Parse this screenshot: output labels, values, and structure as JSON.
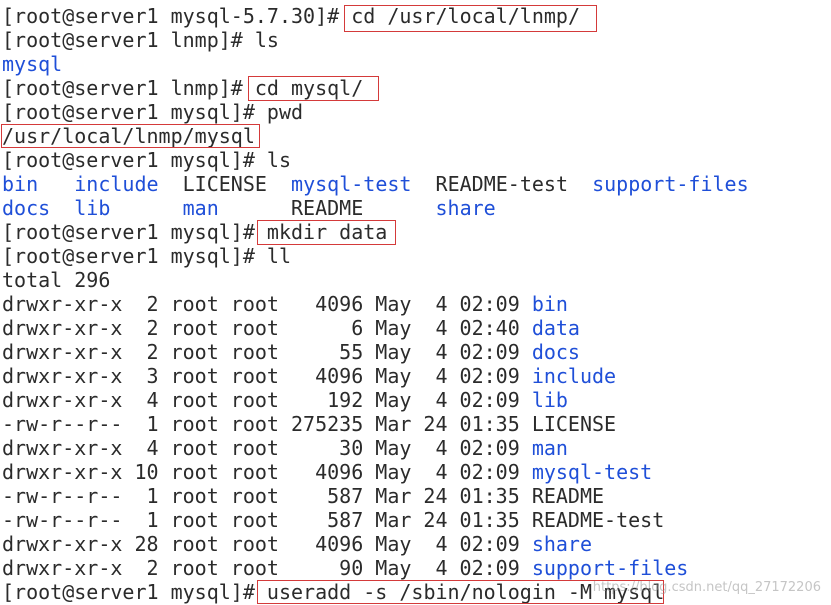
{
  "prompt": "[root@server1 mysql]# ",
  "lines": [
    {
      "prompt": "[root@server1 mysql-5.7.30]# ",
      "cmd": "cd /usr/local/lnmp/"
    },
    {
      "prompt": "[root@server1 lnmp]# ",
      "cmd": "ls"
    },
    {
      "text": "mysql"
    },
    {
      "prompt": "[root@server1 lnmp]# ",
      "cmd": "cd mysql/"
    },
    {
      "prompt": "[root@server1 mysql]# ",
      "cmd": "pwd"
    },
    {
      "text": "/usr/local/lnmp/mysql"
    },
    {
      "prompt": "[root@server1 mysql]# ",
      "cmd": "ls"
    },
    {
      "ls_row": [
        "bin",
        "include",
        "LICENSE",
        "mysql-test",
        "README-test",
        "support-files"
      ]
    },
    {
      "ls_row2": [
        "docs",
        "lib",
        "man",
        "README",
        "share"
      ]
    },
    {
      "prompt": "[root@server1 mysql]# ",
      "cmd": "mkdir data"
    },
    {
      "prompt": "[root@server1 mysql]# ",
      "cmd": "ll"
    },
    {
      "text": "total 296"
    }
  ],
  "listing": [
    {
      "perm": "drwxr-xr-x",
      "links": "2",
      "owner": "root",
      "group": "root",
      "size": "4096",
      "date": "May  4 02:09",
      "name": "bin",
      "dir": true
    },
    {
      "perm": "drwxr-xr-x",
      "links": "2",
      "owner": "root",
      "group": "root",
      "size": "6",
      "date": "May  4 02:40",
      "name": "data",
      "dir": true
    },
    {
      "perm": "drwxr-xr-x",
      "links": "2",
      "owner": "root",
      "group": "root",
      "size": "55",
      "date": "May  4 02:09",
      "name": "docs",
      "dir": true
    },
    {
      "perm": "drwxr-xr-x",
      "links": "3",
      "owner": "root",
      "group": "root",
      "size": "4096",
      "date": "May  4 02:09",
      "name": "include",
      "dir": true
    },
    {
      "perm": "drwxr-xr-x",
      "links": "4",
      "owner": "root",
      "group": "root",
      "size": "192",
      "date": "May  4 02:09",
      "name": "lib",
      "dir": true
    },
    {
      "perm": "-rw-r--r--",
      "links": "1",
      "owner": "root",
      "group": "root",
      "size": "275235",
      "date": "Mar 24 01:35",
      "name": "LICENSE",
      "dir": false
    },
    {
      "perm": "drwxr-xr-x",
      "links": "4",
      "owner": "root",
      "group": "root",
      "size": "30",
      "date": "May  4 02:09",
      "name": "man",
      "dir": true
    },
    {
      "perm": "drwxr-xr-x",
      "links": "10",
      "owner": "root",
      "group": "root",
      "size": "4096",
      "date": "May  4 02:09",
      "name": "mysql-test",
      "dir": true
    },
    {
      "perm": "-rw-r--r--",
      "links": "1",
      "owner": "root",
      "group": "root",
      "size": "587",
      "date": "Mar 24 01:35",
      "name": "README",
      "dir": false
    },
    {
      "perm": "-rw-r--r--",
      "links": "1",
      "owner": "root",
      "group": "root",
      "size": "587",
      "date": "Mar 24 01:35",
      "name": "README-test",
      "dir": false
    },
    {
      "perm": "drwxr-xr-x",
      "links": "28",
      "owner": "root",
      "group": "root",
      "size": "4096",
      "date": "May  4 02:09",
      "name": "share",
      "dir": true
    },
    {
      "perm": "drwxr-xr-x",
      "links": "2",
      "owner": "root",
      "group": "root",
      "size": "90",
      "date": "May  4 02:09",
      "name": "support-files",
      "dir": true
    }
  ],
  "final": {
    "prompt": "[root@server1 mysql]# ",
    "cmd": "useradd -s /sbin/nologin -M mysql"
  },
  "watermark": "https://blog.csdn.net/qq_27172206",
  "colors": {
    "text": "#2b2b2b",
    "directory": "#1f4fd8",
    "highlight_box": "#d43a3a",
    "background": "#ffffff"
  }
}
